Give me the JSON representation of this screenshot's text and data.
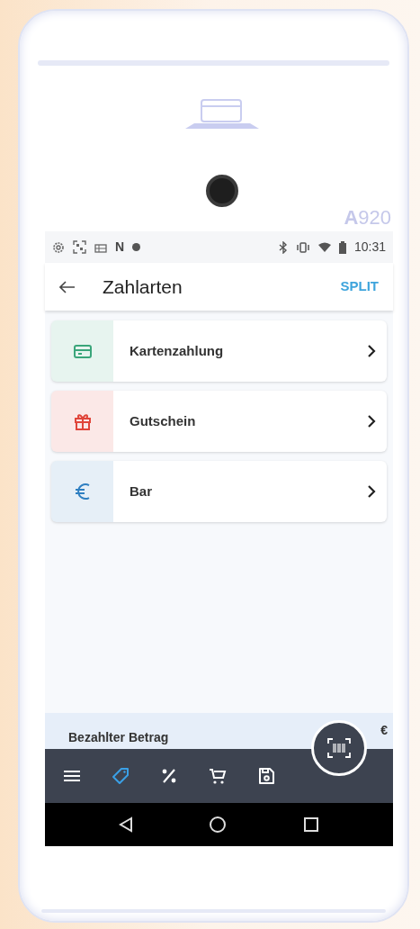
{
  "device": {
    "model_label": "**A**920"
  },
  "status_bar": {
    "glyph": "N",
    "time": "10:31"
  },
  "header": {
    "title": "Zahlarten",
    "action": "SPLIT"
  },
  "payment_methods": [
    {
      "label": "Kartenzahlung",
      "kind": "card",
      "color": "#3aa57a"
    },
    {
      "label": "Gutschein",
      "kind": "gift",
      "color": "#e0453a"
    },
    {
      "label": "Bar",
      "kind": "euro",
      "color": "#2f7fc1"
    }
  ],
  "summary": {
    "label": "Bezahlter Betrag",
    "value": "€"
  },
  "toolbar": [
    {
      "kind": "menu",
      "selected": false
    },
    {
      "kind": "tag",
      "selected": true
    },
    {
      "kind": "percent",
      "selected": false
    },
    {
      "kind": "cart",
      "selected": false
    },
    {
      "kind": "save",
      "selected": false
    }
  ]
}
